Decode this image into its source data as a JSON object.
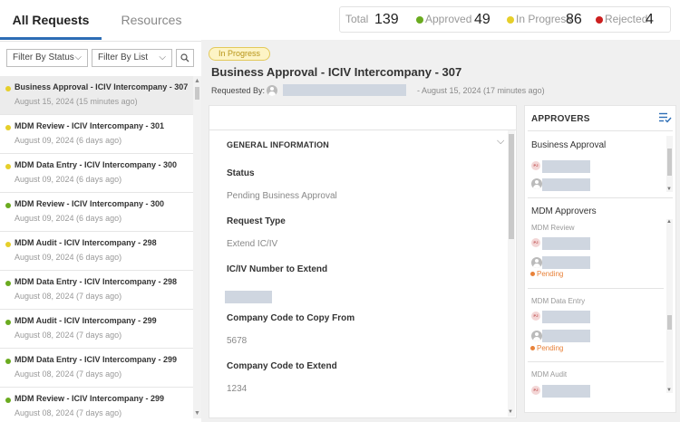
{
  "tabs": {
    "requests": "All Requests",
    "resources": "Resources"
  },
  "filters": {
    "status": "Filter By Status",
    "list": "Filter By List"
  },
  "stats": {
    "total_label": "Total",
    "total": "139",
    "approved_label": "Approved",
    "approved": "49",
    "inprogress_label": "In Progress",
    "inprogress": "86",
    "rejected_label": "Rejected",
    "rejected": "4",
    "colors": {
      "approved": "#6aab1f",
      "inprogress": "#e6cf2a",
      "rejected": "#cc1f1f"
    }
  },
  "requests": [
    {
      "title": "Business Approval - ICIV Intercompany - 307",
      "date": "August 15, 2024 (15 minutes ago)",
      "status": "in-progress"
    },
    {
      "title": "MDM Review - ICIV Intercompany - 301",
      "date": "August 09, 2024 (6 days ago)",
      "status": "in-progress"
    },
    {
      "title": "MDM Data Entry - ICIV Intercompany - 300",
      "date": "August 09, 2024 (6 days ago)",
      "status": "in-progress"
    },
    {
      "title": "MDM Review - ICIV Intercompany - 300",
      "date": "August 09, 2024 (6 days ago)",
      "status": "approved"
    },
    {
      "title": "MDM Audit - ICIV Intercompany - 298",
      "date": "August 09, 2024 (6 days ago)",
      "status": "in-progress"
    },
    {
      "title": "MDM Data Entry - ICIV Intercompany - 298",
      "date": "August 08, 2024 (7 days ago)",
      "status": "approved"
    },
    {
      "title": "MDM Audit - ICIV Intercompany - 299",
      "date": "August 08, 2024 (7 days ago)",
      "status": "approved"
    },
    {
      "title": "MDM Data Entry - ICIV Intercompany - 299",
      "date": "August 08, 2024 (7 days ago)",
      "status": "approved"
    },
    {
      "title": "MDM Review - ICIV Intercompany - 299",
      "date": "August 08, 2024 (7 days ago)",
      "status": "approved"
    }
  ],
  "detail": {
    "badge": "In Progress",
    "title": "Business Approval - ICIV Intercompany - 307",
    "requested_by_label": "Requested By:",
    "date": "- August 15, 2024 (17 minutes ago)",
    "section": "GENERAL INFORMATION",
    "fields": [
      {
        "label": "Status",
        "value": "Pending Business Approval"
      },
      {
        "label": "Request Type",
        "value": "Extend IC/IV"
      },
      {
        "label": "IC/IV Number to Extend",
        "value": ""
      },
      {
        "label": "Company Code to Copy From",
        "value": "5678"
      },
      {
        "label": "Company Code to Extend",
        "value": "1234"
      }
    ]
  },
  "approvers": {
    "title": "APPROVERS",
    "groups": [
      {
        "name": "Business Approval"
      },
      {
        "name": "MDM Approvers",
        "steps": [
          {
            "name": "MDM Review",
            "status": "Pending"
          },
          {
            "name": "MDM Data Entry",
            "status": "Pending"
          },
          {
            "name": "MDM Audit"
          }
        ]
      }
    ]
  }
}
